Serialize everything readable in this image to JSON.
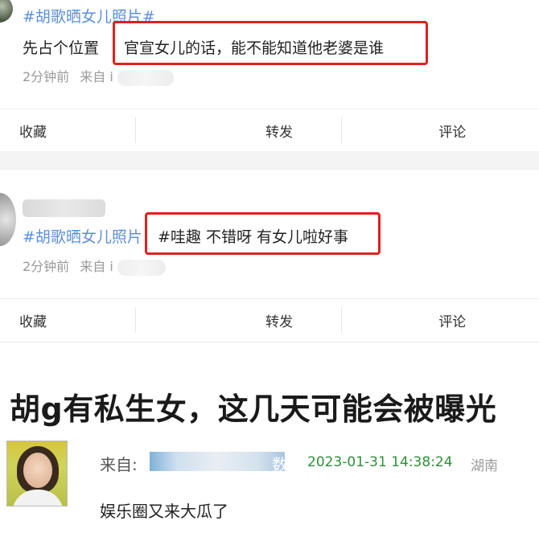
{
  "posts": [
    {
      "hashtag": "#胡歌晒女儿照片#",
      "text_prefix": "先占个位置",
      "text_highlight": "官宣女儿的话，能不能知道他老婆是谁",
      "time": "2分钟前",
      "source_label": "来自 i",
      "actions": {
        "favorite": "收藏",
        "repost": "转发",
        "comment": "评论"
      }
    },
    {
      "hashtag": "#胡歌晒女儿照片",
      "text_highlight": "#哇趣 不错呀 有女儿啦好事",
      "time": "2分钟前",
      "source_label": "来自 i",
      "actions": {
        "favorite": "收藏",
        "repost": "转发",
        "comment": "评论"
      }
    }
  ],
  "headline": "胡g有私生女，这几天可能会被曝光",
  "forum_reply": {
    "from_label": "来自:",
    "from_tail": "数",
    "timestamp": "2023-01-31 14:38:24",
    "region": "湖南",
    "content": "娱乐圈又来大瓜了"
  },
  "colors": {
    "hashtag": "#5d8fd6",
    "highlight_box": "#e02020",
    "timestamp": "#2f8f3a"
  }
}
